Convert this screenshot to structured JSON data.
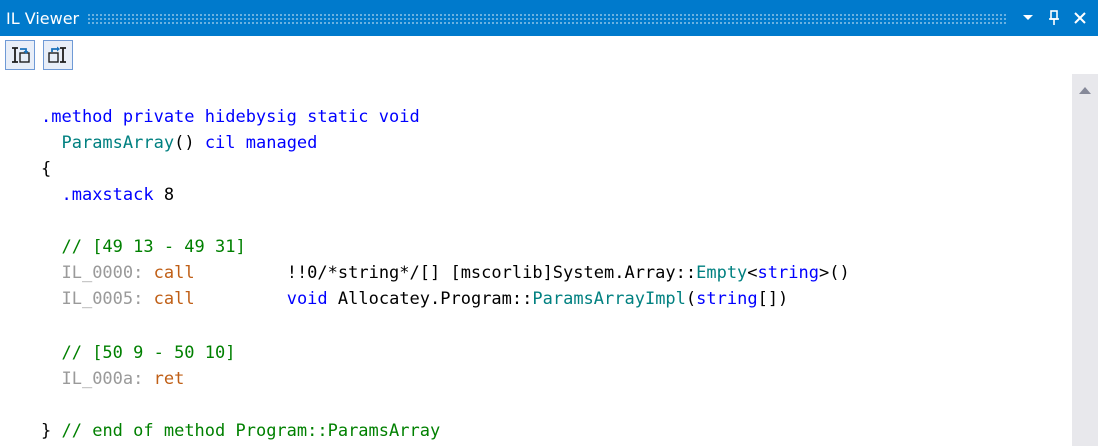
{
  "window": {
    "title": "IL Viewer"
  },
  "toolbar": {
    "buttons": [
      {
        "icon": "go-to-source-icon"
      },
      {
        "icon": "go-to-il-icon"
      }
    ]
  },
  "titlebar_buttons": [
    {
      "icon": "chevron-down-icon"
    },
    {
      "icon": "pin-icon"
    },
    {
      "icon": "close-icon"
    }
  ],
  "code": {
    "l1": {
      "kw1": ".method private hidebysig static void"
    },
    "l2": {
      "name": "ParamsArray",
      "paren": "()",
      "kw": "cil managed"
    },
    "l3": {
      "brace": "{"
    },
    "l4": {
      "kw": ".maxstack",
      "num": "8"
    },
    "l6": {
      "comment": "// [49 13 - 49 31]"
    },
    "l7": {
      "label": "IL_0000:",
      "op": "call",
      "a": "!!0/*string*/[] [mscorlib]System.Array::",
      "b": "Empty",
      "c": "<",
      "d": "string",
      "e": ">()"
    },
    "l8": {
      "label": "IL_0005:",
      "op": "call",
      "a": "void",
      "b": "Allocatey.Program::",
      "c": "ParamsArrayImpl",
      "d": "(",
      "e": "string",
      "f": "[])"
    },
    "l10": {
      "comment": "// [50 9 - 50 10]"
    },
    "l11": {
      "label": "IL_000a:",
      "op": "ret"
    },
    "l13": {
      "brace": "}",
      "comment": "// end of method Program::ParamsArray"
    }
  },
  "colors": {
    "titlebar": "#007acc",
    "keyword": "#0000ff",
    "type": "#008080",
    "comment": "#008000",
    "label": "#9a9a9a",
    "opcode": "#c05f16"
  }
}
